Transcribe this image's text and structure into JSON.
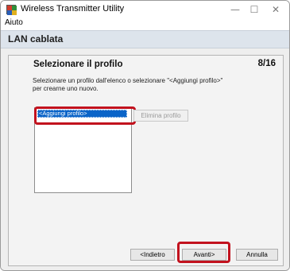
{
  "window": {
    "title": "Wireless Transmitter Utility",
    "controls": {
      "minimize": "—",
      "maximize": "☐",
      "close": "✕"
    }
  },
  "menu": {
    "items": [
      "Aiuto"
    ]
  },
  "header": {
    "title": "LAN cablata"
  },
  "step": {
    "title": "Selezionare il profilo",
    "counter": "8/16",
    "instruction": "Selezionare un profilo dall'elenco o selezionare \"<Aggiungi profilo>\" per crearne uno nuovo."
  },
  "profiles": {
    "items": [
      "<Aggiungi profilo>"
    ],
    "selected": "<Aggiungi profilo>"
  },
  "buttons": {
    "delete_profile": "Elimina profilo",
    "back": "<Indietro",
    "next": "Avanti>",
    "cancel": "Annulla"
  },
  "colors": {
    "highlight": "#c2121e",
    "selection": "#0a64c8",
    "header_band": "#dde4ec"
  }
}
